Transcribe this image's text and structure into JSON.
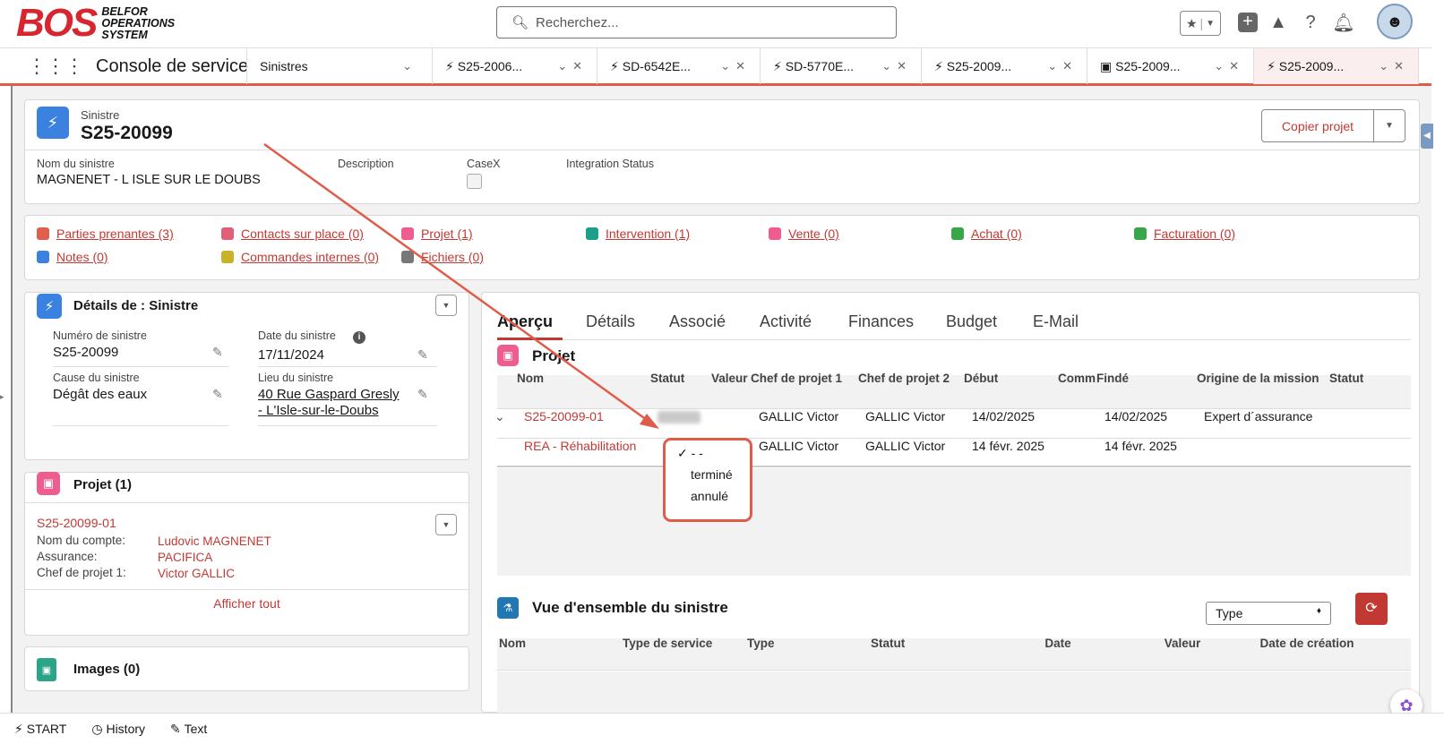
{
  "header": {
    "logo_big": "BOS",
    "logo_line1": "BELFOR",
    "logo_line2": "OPERATIONS",
    "logo_line3": "SYSTEM",
    "search_placeholder": "Recherchez..."
  },
  "nav": {
    "app_name": "Console de service",
    "object_tab": "Sinistres",
    "tabs": [
      {
        "label": "S25-2006...",
        "icon": "lightning-icon"
      },
      {
        "label": "SD-6542E...",
        "icon": "lightning-icon"
      },
      {
        "label": "SD-5770E...",
        "icon": "lightning-icon"
      },
      {
        "label": "S25-2009...",
        "icon": "lightning-icon"
      },
      {
        "label": "S25-2009...",
        "icon": "briefcase-icon"
      },
      {
        "label": "S25-2009...",
        "icon": "lightning-icon"
      }
    ]
  },
  "record": {
    "object_label": "Sinistre",
    "name": "S25-20099",
    "copy_button": "Copier projet",
    "fields": {
      "nom_label": "Nom du sinistre",
      "nom_value": "MAGNENET - L ISLE SUR LE DOUBS",
      "description_label": "Description",
      "casex_label": "CaseX",
      "integration_label": "Integration Status"
    }
  },
  "related_links": [
    {
      "label": "Parties prenantes (3)",
      "color": "#e0604d"
    },
    {
      "label": "Contacts sur place (0)",
      "color": "#e0607a"
    },
    {
      "label": "Projet (1)",
      "color": "#ef5d8f"
    },
    {
      "label": "Intervention (1)",
      "color": "#1b9e8a"
    },
    {
      "label": "Vente (0)",
      "color": "#ef5d8f"
    },
    {
      "label": "Achat (0)",
      "color": "#3aa64a"
    },
    {
      "label": "Facturation (0)",
      "color": "#3aa64a"
    },
    {
      "label": "Notes (0)",
      "color": "#3b82e0"
    },
    {
      "label": "Commandes internes (0)",
      "color": "#c8b22a"
    },
    {
      "label": "Fichiers (0)",
      "color": "#777777"
    }
  ],
  "details": {
    "title": "Détails de : Sinistre",
    "numero_label": "Numéro de sinistre",
    "numero_value": "S25-20099",
    "date_label": "Date du sinistre",
    "date_value": "17/11/2024",
    "cause_label": "Cause du sinistre",
    "cause_value": "Dégât des eaux",
    "lieu_label": "Lieu du sinistre",
    "lieu_line1": "40 Rue Gaspard Gresly",
    "lieu_line2": "- L'Isle-sur-le-Doubs"
  },
  "projet_card": {
    "title": "Projet (1)",
    "record": "S25-20099-01",
    "compte_label": "Nom du compte:",
    "compte_value": "Ludovic MAGNENET",
    "assurance_label": "Assurance:",
    "assurance_value": "PACIFICA",
    "chef_label": "Chef de projet 1:",
    "chef_value": "Victor GALLIC",
    "view_all": "Afficher tout"
  },
  "images_card": {
    "title": "Images (0)"
  },
  "main_tabs": [
    "Aperçu",
    "Détails",
    "Associé",
    "Activité",
    "Finances",
    "Budget",
    "E-Mail"
  ],
  "projet_section": {
    "title": "Projet",
    "columns": [
      "Nom",
      "Statut",
      "Valeur",
      "Chef de projet 1",
      "Chef de projet 2",
      "Début",
      "Comm",
      "Findé",
      "Origine de la mission",
      "Statut"
    ],
    "rows": [
      {
        "nom": "S25-20099-01",
        "chef1": "GALLIC Victor",
        "chef2": "GALLIC Victor",
        "debut": "14/02/2025",
        "fin": "14/02/2025",
        "origine": "Expert d´assurance"
      },
      {
        "nom": "REA - Réhabilitation",
        "chef1": "GALLIC Victor",
        "chef2": "GALLIC Victor",
        "debut": "14 févr. 2025",
        "fin": "14 févr. 2025",
        "origine": ""
      }
    ],
    "status_options": [
      "- -",
      "terminé",
      "annulé"
    ]
  },
  "overview": {
    "title": "Vue d'ensemble du sinistre",
    "type_select": "Type",
    "columns": [
      "Nom",
      "Type de service",
      "Type",
      "Statut",
      "Date",
      "Valeur",
      "Date de création"
    ]
  },
  "bottom": {
    "start": "START",
    "history": "History",
    "text": "Text"
  },
  "colors": {
    "accent": "#c23934",
    "brand": "#d7262f",
    "highlight": "#e05c4a"
  }
}
